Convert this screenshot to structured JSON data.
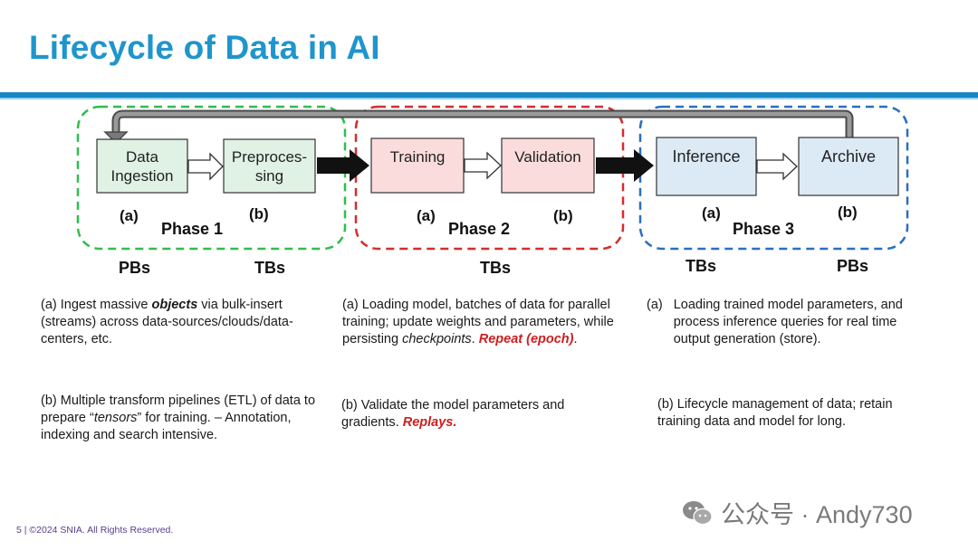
{
  "title": "Lifecycle of Data in AI",
  "boxes": {
    "data_ingestion": "Data Ingestion",
    "preprocessing": "Preproces-sing",
    "training": "Training",
    "validation": "Validation",
    "inference": "Inference",
    "archive": "Archive"
  },
  "labels": {
    "p1a": "(a)",
    "p1b": "(b)",
    "p2a": "(a)",
    "p2b": "(b)",
    "p3a": "(a)",
    "p3b": "(b)"
  },
  "phases": {
    "p1": "Phase 1",
    "p2": "Phase 2",
    "p3": "Phase 3"
  },
  "sizes": {
    "s1": "PBs",
    "s2": "TBs",
    "s3": "TBs",
    "s4": "TBs",
    "s5": "PBs"
  },
  "colors": {
    "phase1": "#2fbe4f",
    "phase2": "#d42d2d",
    "phase3": "#2a6fc2",
    "green_fill": "#dff2e3",
    "red_fill": "#fbdcdc",
    "blue_fill": "#dceaf5",
    "title": "#1f95cc",
    "accent_red": "#cc1f1f"
  },
  "descriptions": {
    "p1a_pre": "(a) Ingest massive ",
    "p1a_em": "objects",
    "p1a_post": " via bulk-insert (streams) across data-sources/clouds/data-centers, etc.",
    "p1b_pre": "(b) Multiple transform pipelines (ETL) of data to prepare “",
    "p1b_em": "tensors",
    "p1b_post": "” for training. – Annotation, indexing and search intensive.",
    "p2a_pre": "(a) Loading model, batches of data for parallel training; update weights and parameters, while persisting ",
    "p2a_em": "checkpoints",
    "p2a_mid": ". ",
    "p2a_red": "Repeat (epoch)",
    "p2a_post": ".",
    "p2b_pre": "(b) Validate the model parameters and gradients. ",
    "p2b_red": "Replays.",
    "p3a_tag": "(a)",
    "p3a_text": "Loading trained model parameters, and process inference queries for real time output generation (store).",
    "p3b": "(b) Lifecycle management of data; retain training data and model for long."
  },
  "footer": "5 | ©2024 SNIA. All Rights Reserved.",
  "watermark": "公众号 · Andy730"
}
